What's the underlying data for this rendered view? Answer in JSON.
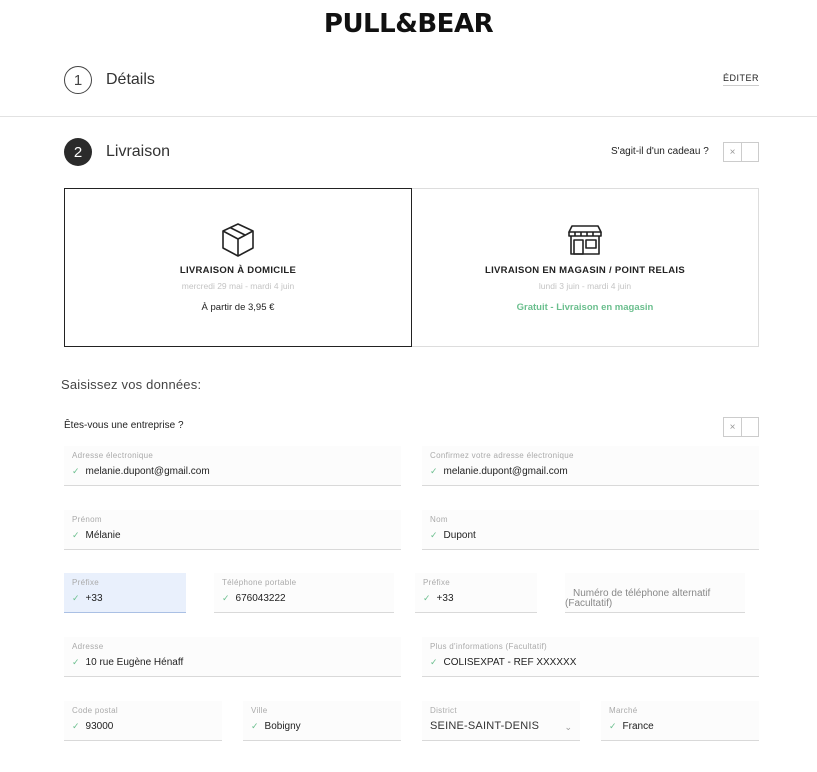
{
  "brand": {
    "logo": "PULL&BEAR"
  },
  "steps": [
    {
      "number": "1",
      "label": "Détails",
      "edit": "ÉDITER"
    },
    {
      "number": "2",
      "label": "Livraison"
    }
  ],
  "gift": {
    "label": "S'agit-il d'un cadeau ?",
    "toggle_icon": "×"
  },
  "shipping": {
    "home": {
      "title": "LIVRAISON À DOMICILE",
      "dates": "mercredi 29 mai - mardi 4 juin",
      "price": "À partir de 3,95 €"
    },
    "store": {
      "title": "LIVRAISON EN MAGASIN / POINT RELAIS",
      "dates": "lundi 3 juin - mardi 4 juin",
      "price": "Gratuit - Livraison en magasin"
    }
  },
  "form": {
    "title": "Saisissez vos données:",
    "company_label": "Êtes-vous une entreprise ?",
    "company_toggle_icon": "×",
    "check": "✓",
    "email": {
      "label": "Adresse électronique",
      "value": "melanie.dupont@gmail.com"
    },
    "email_confirm": {
      "label": "Confirmez votre adresse électronique",
      "value": "melanie.dupont@gmail.com"
    },
    "first_name": {
      "label": "Prénom",
      "value": "Mélanie"
    },
    "last_name": {
      "label": "Nom",
      "value": "Dupont"
    },
    "prefix1": {
      "label": "Préfixe",
      "value": "+33"
    },
    "mobile": {
      "label": "Téléphone portable",
      "value": "676043222"
    },
    "prefix2": {
      "label": "Préfixe",
      "value": "+33"
    },
    "alt_phone": {
      "placeholder_line1": "Numéro de téléphone alternatif",
      "placeholder_line2": "(Facultatif)"
    },
    "address": {
      "label": "Adresse",
      "value": "10 rue Eugène Hénaff"
    },
    "address_more": {
      "label": "Plus d'informations (Facultatif)",
      "value": "COLISEXPAT - REF XXXXXX"
    },
    "postcode": {
      "label": "Code postal",
      "value": "93000"
    },
    "city": {
      "label": "Ville",
      "value": "Bobigny"
    },
    "district": {
      "label": "District",
      "value": "SEINE-SAINT-DENIS",
      "chevron": "⌄"
    },
    "market": {
      "label": "Marché",
      "value": "France"
    }
  },
  "colors": {
    "accent_green": "#6bbf8e",
    "focus_blue": "#e9f0fc",
    "dark": "#2b2b2b"
  }
}
